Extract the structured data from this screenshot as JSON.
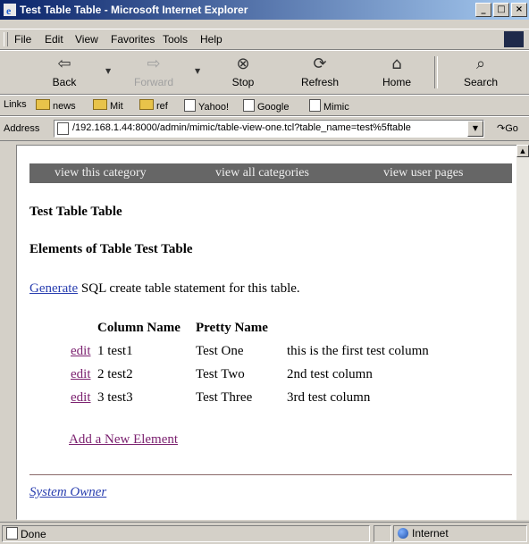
{
  "window": {
    "title": "Test Table Table - Microsoft Internet Explorer",
    "controls": {
      "minimize": "_",
      "maximize": "□",
      "close": "×"
    }
  },
  "menu": [
    "File",
    "Edit",
    "View",
    "Favorites",
    "Tools",
    "Help"
  ],
  "toolbar": {
    "back": "Back",
    "forward": "Forward",
    "stop": "Stop",
    "refresh": "Refresh",
    "home": "Home",
    "search": "Search"
  },
  "links": {
    "label": "Links",
    "items": [
      "news",
      "Mit",
      "ref",
      "Yahoo!",
      "Google",
      "Mimic"
    ]
  },
  "address": {
    "label": "Address",
    "url": "/192.168.1.44:8000/admin/mimic/table-view-one.tcl?table_name=test%5ftable",
    "go": "Go"
  },
  "page": {
    "nav": [
      "view this category",
      "view all categories",
      "view user pages"
    ],
    "title": "Test Table Table",
    "elements_heading": "Elements of Table Test Table",
    "generate_link": "Generate",
    "generate_text": " SQL create table statement for this table.",
    "columns": [
      "Column Name",
      "Pretty Name"
    ],
    "rows": [
      {
        "edit": "edit",
        "name": "1 test1",
        "pretty": "Test One",
        "desc": "this is the first test column"
      },
      {
        "edit": "edit",
        "name": "2 test2",
        "pretty": "Test Two",
        "desc": "2nd test column"
      },
      {
        "edit": "edit",
        "name": "3 test3",
        "pretty": "Test Three",
        "desc": "3rd test column"
      }
    ],
    "add_element": "Add a New Element",
    "system_owner": "System Owner"
  },
  "status": {
    "text": "Done",
    "zone": "Internet"
  },
  "colors": {
    "titlebar_start": "#0a246a",
    "nav_strip": "#666666",
    "link": "#2a3fb0",
    "visited_link": "#7a1f6e"
  },
  "icons": [
    "ie-icon",
    "back-arrow-icon",
    "forward-arrow-icon",
    "stop-icon",
    "refresh-icon",
    "home-icon",
    "search-icon",
    "folder-icon",
    "page-icon",
    "globe-icon"
  ]
}
